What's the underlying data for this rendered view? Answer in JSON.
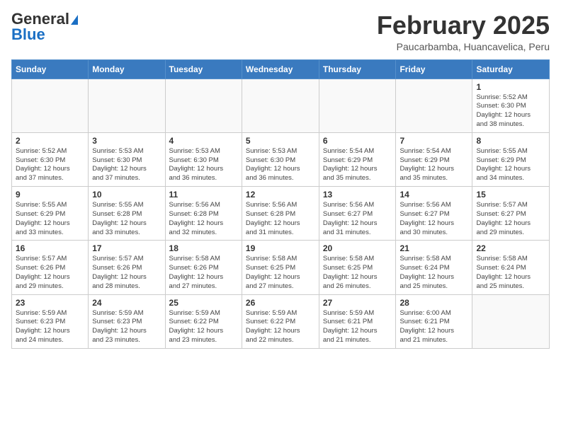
{
  "header": {
    "logo_general": "General",
    "logo_blue": "Blue",
    "month_title": "February 2025",
    "location": "Paucarbamba, Huancavelica, Peru"
  },
  "weekdays": [
    "Sunday",
    "Monday",
    "Tuesday",
    "Wednesday",
    "Thursday",
    "Friday",
    "Saturday"
  ],
  "weeks": [
    [
      {
        "day": "",
        "info": ""
      },
      {
        "day": "",
        "info": ""
      },
      {
        "day": "",
        "info": ""
      },
      {
        "day": "",
        "info": ""
      },
      {
        "day": "",
        "info": ""
      },
      {
        "day": "",
        "info": ""
      },
      {
        "day": "1",
        "info": "Sunrise: 5:52 AM\nSunset: 6:30 PM\nDaylight: 12 hours\nand 38 minutes."
      }
    ],
    [
      {
        "day": "2",
        "info": "Sunrise: 5:52 AM\nSunset: 6:30 PM\nDaylight: 12 hours\nand 37 minutes."
      },
      {
        "day": "3",
        "info": "Sunrise: 5:53 AM\nSunset: 6:30 PM\nDaylight: 12 hours\nand 37 minutes."
      },
      {
        "day": "4",
        "info": "Sunrise: 5:53 AM\nSunset: 6:30 PM\nDaylight: 12 hours\nand 36 minutes."
      },
      {
        "day": "5",
        "info": "Sunrise: 5:53 AM\nSunset: 6:30 PM\nDaylight: 12 hours\nand 36 minutes."
      },
      {
        "day": "6",
        "info": "Sunrise: 5:54 AM\nSunset: 6:29 PM\nDaylight: 12 hours\nand 35 minutes."
      },
      {
        "day": "7",
        "info": "Sunrise: 5:54 AM\nSunset: 6:29 PM\nDaylight: 12 hours\nand 35 minutes."
      },
      {
        "day": "8",
        "info": "Sunrise: 5:55 AM\nSunset: 6:29 PM\nDaylight: 12 hours\nand 34 minutes."
      }
    ],
    [
      {
        "day": "9",
        "info": "Sunrise: 5:55 AM\nSunset: 6:29 PM\nDaylight: 12 hours\nand 33 minutes."
      },
      {
        "day": "10",
        "info": "Sunrise: 5:55 AM\nSunset: 6:28 PM\nDaylight: 12 hours\nand 33 minutes."
      },
      {
        "day": "11",
        "info": "Sunrise: 5:56 AM\nSunset: 6:28 PM\nDaylight: 12 hours\nand 32 minutes."
      },
      {
        "day": "12",
        "info": "Sunrise: 5:56 AM\nSunset: 6:28 PM\nDaylight: 12 hours\nand 31 minutes."
      },
      {
        "day": "13",
        "info": "Sunrise: 5:56 AM\nSunset: 6:27 PM\nDaylight: 12 hours\nand 31 minutes."
      },
      {
        "day": "14",
        "info": "Sunrise: 5:56 AM\nSunset: 6:27 PM\nDaylight: 12 hours\nand 30 minutes."
      },
      {
        "day": "15",
        "info": "Sunrise: 5:57 AM\nSunset: 6:27 PM\nDaylight: 12 hours\nand 29 minutes."
      }
    ],
    [
      {
        "day": "16",
        "info": "Sunrise: 5:57 AM\nSunset: 6:26 PM\nDaylight: 12 hours\nand 29 minutes."
      },
      {
        "day": "17",
        "info": "Sunrise: 5:57 AM\nSunset: 6:26 PM\nDaylight: 12 hours\nand 28 minutes."
      },
      {
        "day": "18",
        "info": "Sunrise: 5:58 AM\nSunset: 6:26 PM\nDaylight: 12 hours\nand 27 minutes."
      },
      {
        "day": "19",
        "info": "Sunrise: 5:58 AM\nSunset: 6:25 PM\nDaylight: 12 hours\nand 27 minutes."
      },
      {
        "day": "20",
        "info": "Sunrise: 5:58 AM\nSunset: 6:25 PM\nDaylight: 12 hours\nand 26 minutes."
      },
      {
        "day": "21",
        "info": "Sunrise: 5:58 AM\nSunset: 6:24 PM\nDaylight: 12 hours\nand 25 minutes."
      },
      {
        "day": "22",
        "info": "Sunrise: 5:58 AM\nSunset: 6:24 PM\nDaylight: 12 hours\nand 25 minutes."
      }
    ],
    [
      {
        "day": "23",
        "info": "Sunrise: 5:59 AM\nSunset: 6:23 PM\nDaylight: 12 hours\nand 24 minutes."
      },
      {
        "day": "24",
        "info": "Sunrise: 5:59 AM\nSunset: 6:23 PM\nDaylight: 12 hours\nand 23 minutes."
      },
      {
        "day": "25",
        "info": "Sunrise: 5:59 AM\nSunset: 6:22 PM\nDaylight: 12 hours\nand 23 minutes."
      },
      {
        "day": "26",
        "info": "Sunrise: 5:59 AM\nSunset: 6:22 PM\nDaylight: 12 hours\nand 22 minutes."
      },
      {
        "day": "27",
        "info": "Sunrise: 5:59 AM\nSunset: 6:21 PM\nDaylight: 12 hours\nand 21 minutes."
      },
      {
        "day": "28",
        "info": "Sunrise: 6:00 AM\nSunset: 6:21 PM\nDaylight: 12 hours\nand 21 minutes."
      },
      {
        "day": "",
        "info": ""
      }
    ]
  ]
}
